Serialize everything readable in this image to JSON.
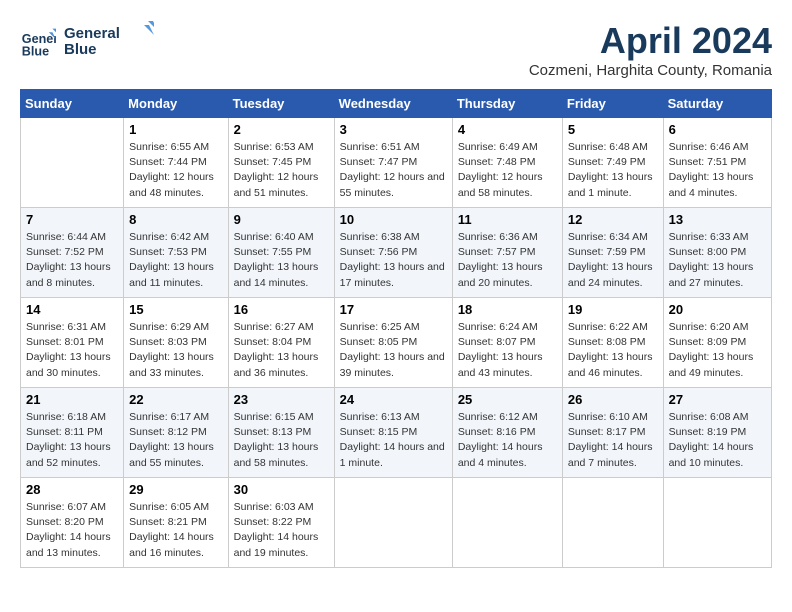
{
  "header": {
    "logo_line1": "General",
    "logo_line2": "Blue",
    "month_title": "April 2024",
    "location": "Cozmeni, Harghita County, Romania"
  },
  "weekdays": [
    "Sunday",
    "Monday",
    "Tuesday",
    "Wednesday",
    "Thursday",
    "Friday",
    "Saturday"
  ],
  "weeks": [
    [
      {
        "day": "",
        "sunrise": "",
        "sunset": "",
        "daylight": ""
      },
      {
        "day": "1",
        "sunrise": "Sunrise: 6:55 AM",
        "sunset": "Sunset: 7:44 PM",
        "daylight": "Daylight: 12 hours and 48 minutes."
      },
      {
        "day": "2",
        "sunrise": "Sunrise: 6:53 AM",
        "sunset": "Sunset: 7:45 PM",
        "daylight": "Daylight: 12 hours and 51 minutes."
      },
      {
        "day": "3",
        "sunrise": "Sunrise: 6:51 AM",
        "sunset": "Sunset: 7:47 PM",
        "daylight": "Daylight: 12 hours and 55 minutes."
      },
      {
        "day": "4",
        "sunrise": "Sunrise: 6:49 AM",
        "sunset": "Sunset: 7:48 PM",
        "daylight": "Daylight: 12 hours and 58 minutes."
      },
      {
        "day": "5",
        "sunrise": "Sunrise: 6:48 AM",
        "sunset": "Sunset: 7:49 PM",
        "daylight": "Daylight: 13 hours and 1 minute."
      },
      {
        "day": "6",
        "sunrise": "Sunrise: 6:46 AM",
        "sunset": "Sunset: 7:51 PM",
        "daylight": "Daylight: 13 hours and 4 minutes."
      }
    ],
    [
      {
        "day": "7",
        "sunrise": "Sunrise: 6:44 AM",
        "sunset": "Sunset: 7:52 PM",
        "daylight": "Daylight: 13 hours and 8 minutes."
      },
      {
        "day": "8",
        "sunrise": "Sunrise: 6:42 AM",
        "sunset": "Sunset: 7:53 PM",
        "daylight": "Daylight: 13 hours and 11 minutes."
      },
      {
        "day": "9",
        "sunrise": "Sunrise: 6:40 AM",
        "sunset": "Sunset: 7:55 PM",
        "daylight": "Daylight: 13 hours and 14 minutes."
      },
      {
        "day": "10",
        "sunrise": "Sunrise: 6:38 AM",
        "sunset": "Sunset: 7:56 PM",
        "daylight": "Daylight: 13 hours and 17 minutes."
      },
      {
        "day": "11",
        "sunrise": "Sunrise: 6:36 AM",
        "sunset": "Sunset: 7:57 PM",
        "daylight": "Daylight: 13 hours and 20 minutes."
      },
      {
        "day": "12",
        "sunrise": "Sunrise: 6:34 AM",
        "sunset": "Sunset: 7:59 PM",
        "daylight": "Daylight: 13 hours and 24 minutes."
      },
      {
        "day": "13",
        "sunrise": "Sunrise: 6:33 AM",
        "sunset": "Sunset: 8:00 PM",
        "daylight": "Daylight: 13 hours and 27 minutes."
      }
    ],
    [
      {
        "day": "14",
        "sunrise": "Sunrise: 6:31 AM",
        "sunset": "Sunset: 8:01 PM",
        "daylight": "Daylight: 13 hours and 30 minutes."
      },
      {
        "day": "15",
        "sunrise": "Sunrise: 6:29 AM",
        "sunset": "Sunset: 8:03 PM",
        "daylight": "Daylight: 13 hours and 33 minutes."
      },
      {
        "day": "16",
        "sunrise": "Sunrise: 6:27 AM",
        "sunset": "Sunset: 8:04 PM",
        "daylight": "Daylight: 13 hours and 36 minutes."
      },
      {
        "day": "17",
        "sunrise": "Sunrise: 6:25 AM",
        "sunset": "Sunset: 8:05 PM",
        "daylight": "Daylight: 13 hours and 39 minutes."
      },
      {
        "day": "18",
        "sunrise": "Sunrise: 6:24 AM",
        "sunset": "Sunset: 8:07 PM",
        "daylight": "Daylight: 13 hours and 43 minutes."
      },
      {
        "day": "19",
        "sunrise": "Sunrise: 6:22 AM",
        "sunset": "Sunset: 8:08 PM",
        "daylight": "Daylight: 13 hours and 46 minutes."
      },
      {
        "day": "20",
        "sunrise": "Sunrise: 6:20 AM",
        "sunset": "Sunset: 8:09 PM",
        "daylight": "Daylight: 13 hours and 49 minutes."
      }
    ],
    [
      {
        "day": "21",
        "sunrise": "Sunrise: 6:18 AM",
        "sunset": "Sunset: 8:11 PM",
        "daylight": "Daylight: 13 hours and 52 minutes."
      },
      {
        "day": "22",
        "sunrise": "Sunrise: 6:17 AM",
        "sunset": "Sunset: 8:12 PM",
        "daylight": "Daylight: 13 hours and 55 minutes."
      },
      {
        "day": "23",
        "sunrise": "Sunrise: 6:15 AM",
        "sunset": "Sunset: 8:13 PM",
        "daylight": "Daylight: 13 hours and 58 minutes."
      },
      {
        "day": "24",
        "sunrise": "Sunrise: 6:13 AM",
        "sunset": "Sunset: 8:15 PM",
        "daylight": "Daylight: 14 hours and 1 minute."
      },
      {
        "day": "25",
        "sunrise": "Sunrise: 6:12 AM",
        "sunset": "Sunset: 8:16 PM",
        "daylight": "Daylight: 14 hours and 4 minutes."
      },
      {
        "day": "26",
        "sunrise": "Sunrise: 6:10 AM",
        "sunset": "Sunset: 8:17 PM",
        "daylight": "Daylight: 14 hours and 7 minutes."
      },
      {
        "day": "27",
        "sunrise": "Sunrise: 6:08 AM",
        "sunset": "Sunset: 8:19 PM",
        "daylight": "Daylight: 14 hours and 10 minutes."
      }
    ],
    [
      {
        "day": "28",
        "sunrise": "Sunrise: 6:07 AM",
        "sunset": "Sunset: 8:20 PM",
        "daylight": "Daylight: 14 hours and 13 minutes."
      },
      {
        "day": "29",
        "sunrise": "Sunrise: 6:05 AM",
        "sunset": "Sunset: 8:21 PM",
        "daylight": "Daylight: 14 hours and 16 minutes."
      },
      {
        "day": "30",
        "sunrise": "Sunrise: 6:03 AM",
        "sunset": "Sunset: 8:22 PM",
        "daylight": "Daylight: 14 hours and 19 minutes."
      },
      {
        "day": "",
        "sunrise": "",
        "sunset": "",
        "daylight": ""
      },
      {
        "day": "",
        "sunrise": "",
        "sunset": "",
        "daylight": ""
      },
      {
        "day": "",
        "sunrise": "",
        "sunset": "",
        "daylight": ""
      },
      {
        "day": "",
        "sunrise": "",
        "sunset": "",
        "daylight": ""
      }
    ]
  ]
}
